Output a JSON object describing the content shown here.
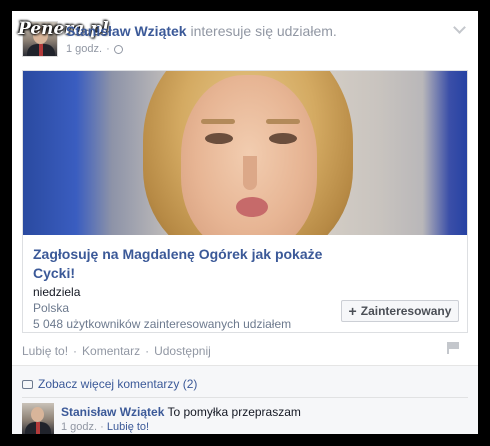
{
  "watermark": "Pe",
  "watermark_brand": "Penera.pl",
  "post": {
    "author": "Stanisław Wziątek",
    "action": "interesuje się udziałem.",
    "time": "1 godz.",
    "privacy_icon": "globe-icon",
    "options_icon": "chevron-down-icon"
  },
  "event": {
    "title": "Zagłosuję na Magdalenę Ogórek jak pokaże Cycki!",
    "date": "niedziela",
    "place": "Polska",
    "interested_count": "5 048 użytkowników zainteresowanych udziałem",
    "button_label": "Zainteresowany",
    "button_icon": "plus-icon"
  },
  "actions": {
    "like": "Lubię to!",
    "comment": "Komentarz",
    "share": "Udostępnij",
    "separator": "·"
  },
  "comments": {
    "more_label": "Zobacz więcej komentarzy (2)",
    "items": [
      {
        "author": "Stanisław Wziątek",
        "text": "To pomyłka przepraszam",
        "time": "1 godz.",
        "like": "Lubię to!"
      }
    ]
  },
  "colors": {
    "link": "#3b5998",
    "muted": "#9197a3",
    "comments_bg": "#f6f7f9"
  }
}
